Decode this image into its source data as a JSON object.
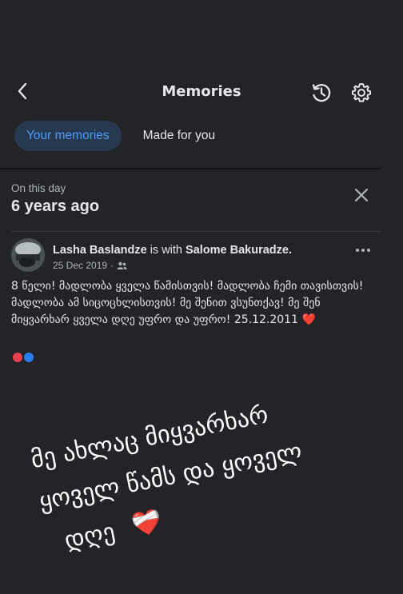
{
  "header": {
    "title": "Memories",
    "back_icon": "chevron-left-icon",
    "history_icon": "history-icon",
    "settings_icon": "gear-icon"
  },
  "tabs": [
    {
      "label": "Your memories",
      "active": true
    },
    {
      "label": "Made for you",
      "active": false
    }
  ],
  "memory": {
    "section_label": "On this day",
    "time_ago": "6 years ago"
  },
  "post": {
    "author": "Lasha Baslandze",
    "with_text": "is with",
    "tagged": "Salome Bakuradze.",
    "date": "25 Dec 2019",
    "audience_icon": "friends-icon",
    "body": "8 წელი! მადლობა ყველა წამისთვის! მადლობა ჩემი თავისთვის! მადლობა ამ სიცოცხლისთვის! მე შენით ვსუნთქავ! მე შენ მიყვარხარ ყველა დღე უფრო და უფრო! 25.12.2011",
    "body_emoji": "❤️"
  },
  "overlay_text": {
    "line1": "მე ახლაც მიყვარხარ",
    "line2": "ყოველ წამს და ყოველ",
    "line3": "დღე",
    "emoji": "❤️‍🩹"
  },
  "colors": {
    "background": "#232427",
    "tab_active_bg": "#263951",
    "tab_active_text": "#4c9df7",
    "heart": "#e8212b"
  }
}
